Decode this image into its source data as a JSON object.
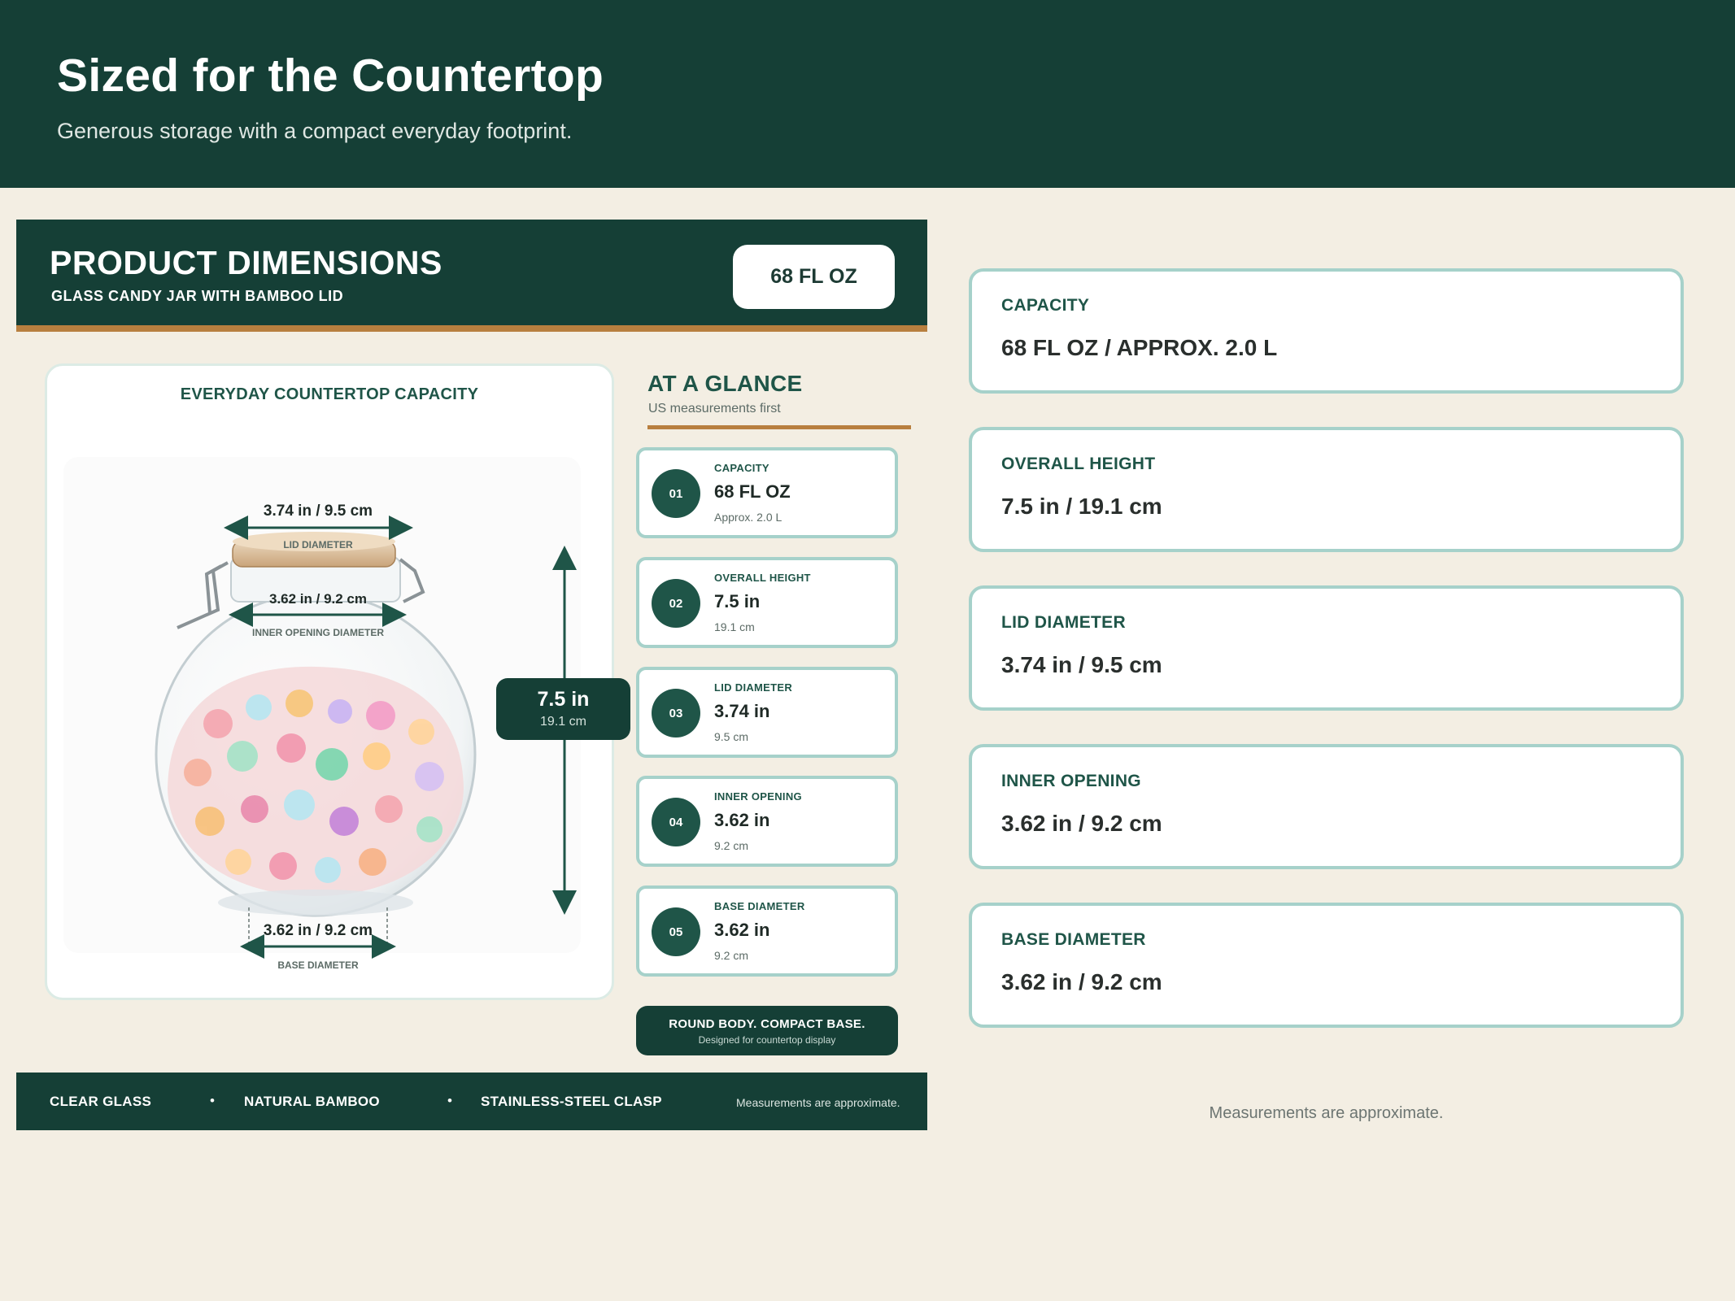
{
  "header": {
    "title": "Sized for the Countertop",
    "subtitle": "Generous storage with a compact everyday footprint."
  },
  "card": {
    "title": "PRODUCT DIMENSIONS",
    "subtitle": "GLASS CANDY JAR WITH BAMBOO LID",
    "capacity_badge": "68 FL OZ",
    "image_panel": {
      "title": "EVERYDAY COUNTERTOP CAPACITY",
      "lid_value": "3.74 in  /  9.5 cm",
      "lid_label": "LID DIAMETER",
      "inner_value": "3.62 in  /  9.2 cm",
      "inner_label": "INNER OPENING DIAMETER",
      "base_value": "3.62 in  /  9.2 cm",
      "base_label": "BASE DIAMETER",
      "height_main": "7.5 in",
      "height_sub": "19.1 cm"
    },
    "glance": {
      "title": "AT A GLANCE",
      "subtitle": "US measurements first",
      "items": [
        {
          "num": "01",
          "label": "CAPACITY",
          "value": "68 FL OZ",
          "sub": "Approx. 2.0 L"
        },
        {
          "num": "02",
          "label": "OVERALL HEIGHT",
          "value": "7.5 in",
          "sub": "19.1 cm"
        },
        {
          "num": "03",
          "label": "LID DIAMETER",
          "value": "3.74 in",
          "sub": "9.5 cm"
        },
        {
          "num": "04",
          "label": "INNER OPENING",
          "value": "3.62 in",
          "sub": "9.2 cm"
        },
        {
          "num": "05",
          "label": "BASE DIAMETER",
          "value": "3.62 in",
          "sub": "9.2 cm"
        }
      ],
      "callout_main": "ROUND BODY. COMPACT BASE.",
      "callout_sub": "Designed for countertop display"
    },
    "footer": {
      "materials": [
        "CLEAR GLASS",
        "NATURAL BAMBOO",
        "STAINLESS-STEEL CLASP"
      ],
      "separator": "•",
      "note": "Measurements are approximate."
    }
  },
  "specs": [
    {
      "label": "CAPACITY",
      "value": "68 FL OZ / APPROX. 2.0 L"
    },
    {
      "label": "OVERALL HEIGHT",
      "value": "7.5 in / 19.1 cm"
    },
    {
      "label": "LID DIAMETER",
      "value": "3.74 in / 9.5 cm"
    },
    {
      "label": "INNER OPENING",
      "value": "3.62 in / 9.2 cm"
    },
    {
      "label": "BASE DIAMETER",
      "value": "3.62 in / 9.2 cm"
    }
  ],
  "right_note": "Measurements are approximate.",
  "colors": {
    "brand_dark_green": "#153f36",
    "accent_green": "#1f5548",
    "accent_bronze": "#b87f3f",
    "card_border": "#a6d1ca",
    "background": "#f3eee3"
  }
}
